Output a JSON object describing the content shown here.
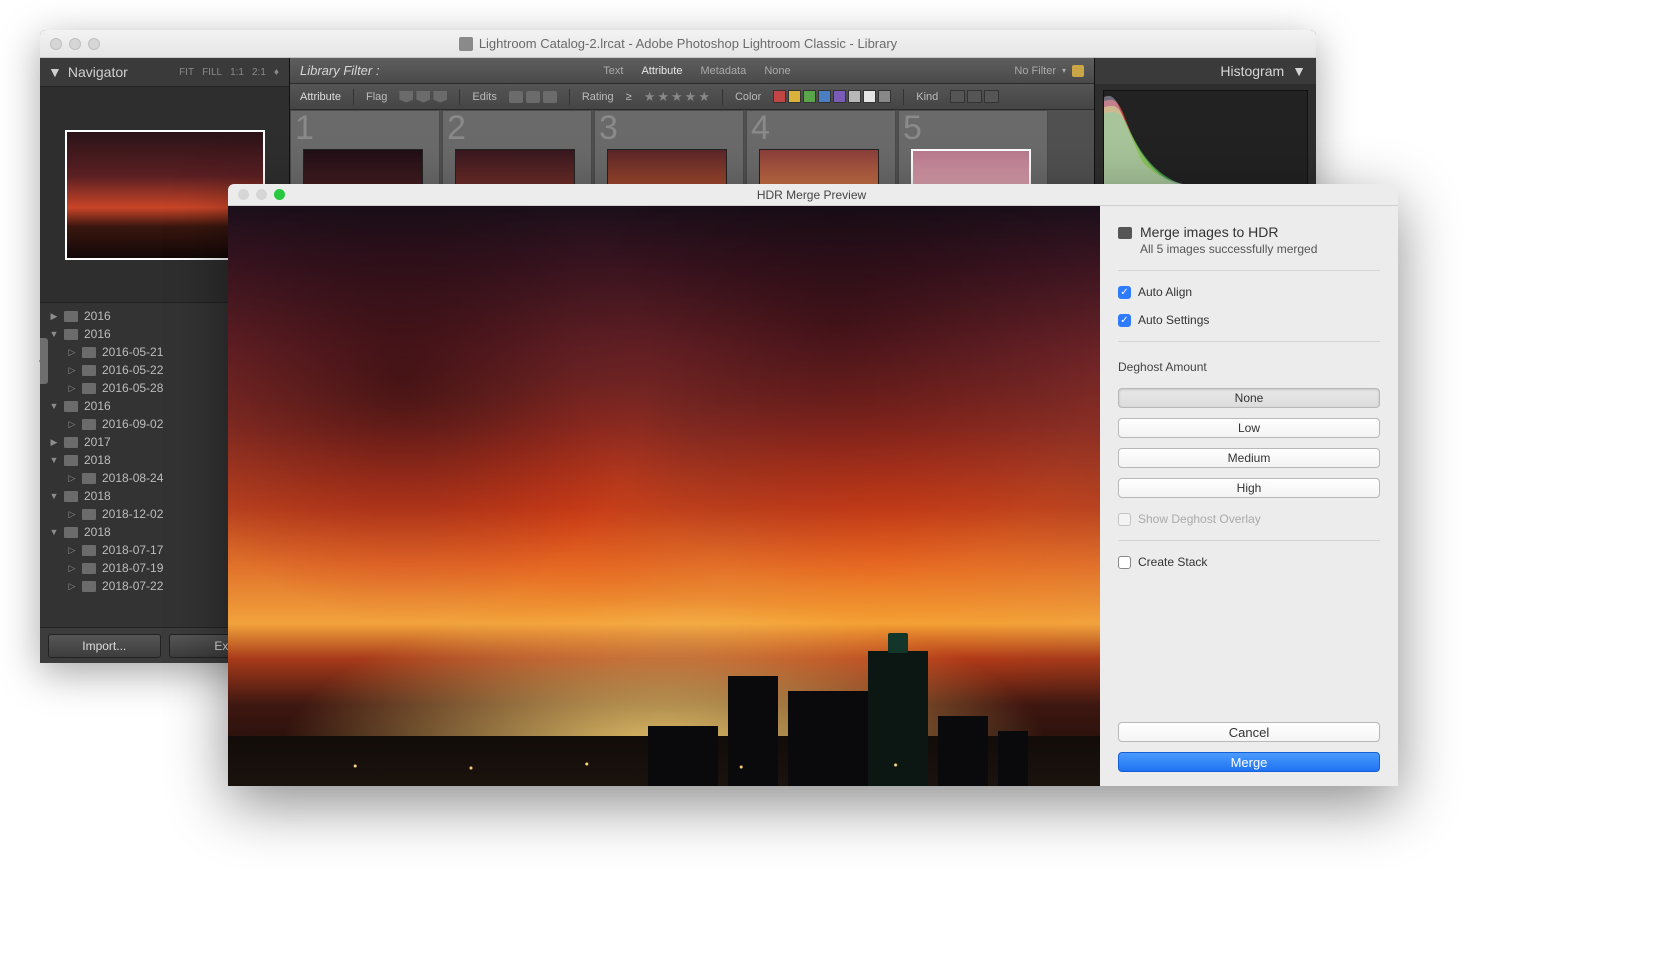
{
  "lightroom": {
    "title": "Lightroom Catalog-2.lrcat - Adobe Photoshop Lightroom Classic - Library",
    "navigator": {
      "label": "Navigator",
      "fit": "FIT",
      "fill": "FILL",
      "one": "1:1",
      "two": "2:1"
    },
    "library_filter_label": "Library Filter :",
    "filter_tabs": {
      "text": "Text",
      "attribute": "Attribute",
      "metadata": "Metadata",
      "none": "None"
    },
    "no_filter": "No Filter",
    "attr_bar": {
      "attribute": "Attribute",
      "flag": "Flag",
      "edits": "Edits",
      "rating": "Rating",
      "color": "Color",
      "kind": "Kind"
    },
    "histogram_label": "Histogram",
    "folders": [
      {
        "depth": 0,
        "arrow": "▶",
        "label": "2016"
      },
      {
        "depth": 0,
        "arrow": "▼",
        "label": "2016"
      },
      {
        "depth": 1,
        "arrow": "▷",
        "label": "2016-05-21"
      },
      {
        "depth": 1,
        "arrow": "▷",
        "label": "2016-05-22"
      },
      {
        "depth": 1,
        "arrow": "▷",
        "label": "2016-05-28"
      },
      {
        "depth": 0,
        "arrow": "▼",
        "label": "2016"
      },
      {
        "depth": 1,
        "arrow": "▷",
        "label": "2016-09-02"
      },
      {
        "depth": 0,
        "arrow": "▶",
        "label": "2017"
      },
      {
        "depth": 0,
        "arrow": "▼",
        "label": "2018"
      },
      {
        "depth": 1,
        "arrow": "▷",
        "label": "2018-08-24"
      },
      {
        "depth": 0,
        "arrow": "▼",
        "label": "2018"
      },
      {
        "depth": 1,
        "arrow": "▷",
        "label": "2018-12-02"
      },
      {
        "depth": 0,
        "arrow": "▼",
        "label": "2018"
      },
      {
        "depth": 1,
        "arrow": "▷",
        "label": "2018-07-17"
      },
      {
        "depth": 1,
        "arrow": "▷",
        "label": "2018-07-19"
      },
      {
        "depth": 1,
        "arrow": "▷",
        "label": "2018-07-22"
      }
    ],
    "import_btn": "Import...",
    "export_btn": "Exp",
    "thumbs": [
      "1",
      "2",
      "3",
      "4",
      "5"
    ],
    "thumb_gradients": [
      "linear-gradient(180deg,#200f16,#4a1f22 55%,#1a0d0b)",
      "linear-gradient(180deg,#37171f,#7a322a 55%,#2a120e)",
      "linear-gradient(180deg,#5a2528,#b05030 55%,#4a1e14)",
      "linear-gradient(180deg,#8a3d3a,#d37a46 55%,#6d2e1c)",
      "linear-gradient(180deg,#b97a8e,#e3a9b5 55%,#9a5e6c)"
    ],
    "swatch_colors": [
      "#c24545",
      "#d8b23a",
      "#5aa44a",
      "#4a7fc2",
      "#7a5bb8",
      "#b8b8b8",
      "#e4e4e4",
      "#888"
    ]
  },
  "hdr": {
    "title": "HDR Merge Preview",
    "heading": "Merge images to HDR",
    "subheading": "All 5 images successfully merged",
    "auto_align": "Auto Align",
    "auto_settings": "Auto Settings",
    "deghost_label": "Deghost Amount",
    "deghost": {
      "none": "None",
      "low": "Low",
      "medium": "Medium",
      "high": "High"
    },
    "show_overlay": "Show Deghost Overlay",
    "create_stack": "Create Stack",
    "cancel": "Cancel",
    "merge": "Merge"
  }
}
